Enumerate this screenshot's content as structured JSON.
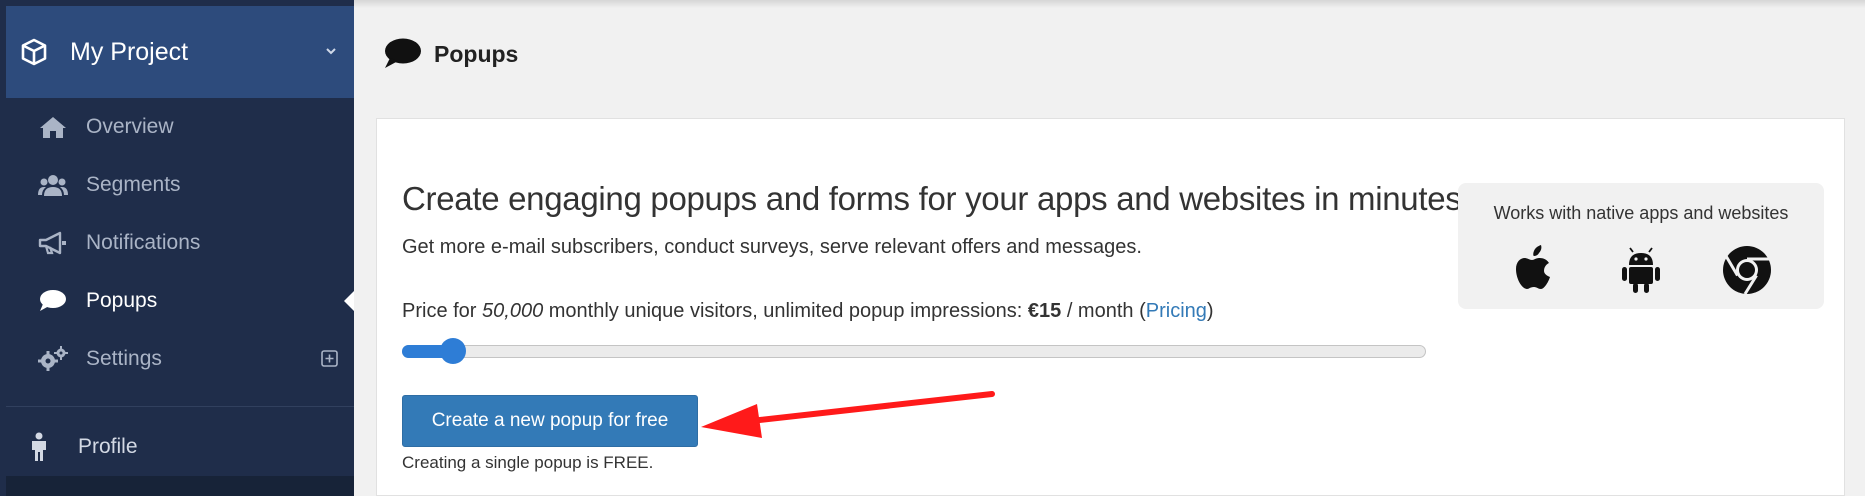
{
  "sidebar": {
    "project_title": "My Project",
    "items": [
      {
        "label": "Overview",
        "icon": "home-icon"
      },
      {
        "label": "Segments",
        "icon": "users-icon"
      },
      {
        "label": "Notifications",
        "icon": "bullhorn-icon"
      },
      {
        "label": "Popups",
        "icon": "comment-icon",
        "active": true
      },
      {
        "label": "Settings",
        "icon": "gears-icon"
      }
    ],
    "profile_label": "Profile"
  },
  "page": {
    "title": "Popups"
  },
  "content": {
    "headline": "Create engaging popups and forms for your apps and websites in minutes.",
    "subline": "Get more e-mail subscribers, conduct surveys, serve relevant offers and messages.",
    "price": {
      "prefix": "Price for ",
      "visitors": "50,000",
      "middle": " monthly unique visitors, unlimited popup impressions: ",
      "amount": "€15",
      "period": " / month (",
      "pricing_link": "Pricing",
      "suffix": ")"
    },
    "slider_value_fraction": 0.05,
    "cta_label": "Create a new popup for free",
    "cta_note": "Creating a single popup is FREE.",
    "works_with": "Works with native apps and websites",
    "platforms": [
      "apple-icon",
      "android-icon",
      "chrome-icon"
    ]
  },
  "colors": {
    "sidebar_bg": "#1f2d4a",
    "project_header_bg": "#2d4b7c",
    "primary": "#337ab7",
    "slider": "#2e7dd6",
    "arrow": "#ff1a1a"
  }
}
